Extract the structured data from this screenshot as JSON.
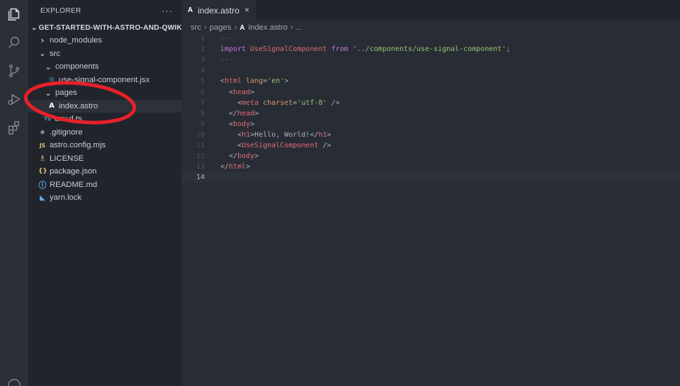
{
  "sidebar": {
    "title": "EXPLORER",
    "more": "···",
    "project": "GET-STARTED-WITH-ASTRO-AND-QWIK",
    "items": [
      {
        "label": "node_modules",
        "icon": "›",
        "icon_name": "chevron-right-icon"
      },
      {
        "label": "src",
        "icon": "⌄",
        "icon_name": "chevron-down-icon"
      },
      {
        "label": "components",
        "icon": "⌄",
        "icon_name": "chevron-down-icon"
      },
      {
        "label": "use-signal-component.jsx",
        "icon": "⚛",
        "icon_name": "react-file-icon"
      },
      {
        "label": "pages",
        "icon": "⌄",
        "icon_name": "chevron-down-icon"
      },
      {
        "label": "index.astro",
        "icon": "A",
        "icon_name": "astro-file-icon"
      },
      {
        "label": "env.d.ts",
        "icon": "TS",
        "icon_name": "typescript-file-icon"
      },
      {
        "label": ".gitignore",
        "icon": "◆",
        "icon_name": "git-file-icon"
      },
      {
        "label": "astro.config.mjs",
        "icon": "JS",
        "icon_name": "javascript-file-icon"
      },
      {
        "label": "LICENSE",
        "icon": "♗",
        "icon_name": "license-file-icon"
      },
      {
        "label": "package.json",
        "icon": "{}",
        "icon_name": "json-file-icon"
      },
      {
        "label": "README.md",
        "icon": "ⓘ",
        "icon_name": "readme-file-icon"
      },
      {
        "label": "yarn.lock",
        "icon": "◣",
        "icon_name": "yarn-file-icon"
      }
    ]
  },
  "editor": {
    "tab_label": "index.astro",
    "tab_close": "×",
    "breadcrumb": [
      "src",
      "pages",
      "index.astro",
      "..."
    ]
  },
  "code": {
    "line_numbers": [
      "1",
      "2",
      "3",
      "4",
      "5",
      "6",
      "7",
      "8",
      "9",
      "10",
      "11",
      "12",
      "13",
      "14"
    ],
    "current_line": 14
  },
  "colors": {
    "activity_bar": "#2b2f36",
    "sidebar": "#21252b",
    "editor": "#282c34",
    "annotation": "#e8202a"
  }
}
